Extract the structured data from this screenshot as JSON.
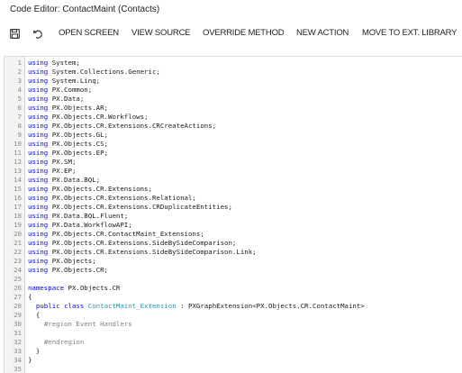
{
  "window": {
    "title": "Code Editor: ContactMaint (Contacts)"
  },
  "toolbar": {
    "save_icon": "save-icon",
    "undo_icon": "undo-icon",
    "buttons": [
      "OPEN SCREEN",
      "VIEW SOURCE",
      "OVERRIDE METHOD",
      "NEW ACTION",
      "MOVE TO EXT. LIBRARY"
    ]
  },
  "editor": {
    "lines": [
      {
        "n": "1",
        "segs": [
          {
            "t": "using",
            "c": "kw"
          },
          {
            "t": " System;",
            "c": ""
          }
        ]
      },
      {
        "n": "2",
        "segs": [
          {
            "t": "using",
            "c": "kw"
          },
          {
            "t": " System.Collections.Generic;",
            "c": ""
          }
        ]
      },
      {
        "n": "3",
        "segs": [
          {
            "t": "using",
            "c": "kw"
          },
          {
            "t": " System.Linq;",
            "c": ""
          }
        ]
      },
      {
        "n": "4",
        "segs": [
          {
            "t": "using",
            "c": "kw"
          },
          {
            "t": " PX.Common;",
            "c": ""
          }
        ]
      },
      {
        "n": "5",
        "segs": [
          {
            "t": "using",
            "c": "kw"
          },
          {
            "t": " PX.Data;",
            "c": ""
          }
        ]
      },
      {
        "n": "6",
        "segs": [
          {
            "t": "using",
            "c": "kw"
          },
          {
            "t": " PX.Objects.AR;",
            "c": ""
          }
        ]
      },
      {
        "n": "7",
        "segs": [
          {
            "t": "using",
            "c": "kw"
          },
          {
            "t": " PX.Objects.CR.Workflows;",
            "c": ""
          }
        ]
      },
      {
        "n": "8",
        "segs": [
          {
            "t": "using",
            "c": "kw"
          },
          {
            "t": " PX.Objects.CR.Extensions.CRCreateActions;",
            "c": ""
          }
        ]
      },
      {
        "n": "9",
        "segs": [
          {
            "t": "using",
            "c": "kw"
          },
          {
            "t": " PX.Objects.GL;",
            "c": ""
          }
        ]
      },
      {
        "n": "10",
        "segs": [
          {
            "t": "using",
            "c": "kw"
          },
          {
            "t": " PX.Objects.CS;",
            "c": ""
          }
        ]
      },
      {
        "n": "11",
        "segs": [
          {
            "t": "using",
            "c": "kw"
          },
          {
            "t": " PX.Objects.EP;",
            "c": ""
          }
        ]
      },
      {
        "n": "12",
        "segs": [
          {
            "t": "using",
            "c": "kw"
          },
          {
            "t": " PX.SM;",
            "c": ""
          }
        ]
      },
      {
        "n": "13",
        "segs": [
          {
            "t": "using",
            "c": "kw"
          },
          {
            "t": " PX.EP;",
            "c": ""
          }
        ]
      },
      {
        "n": "14",
        "segs": [
          {
            "t": "using",
            "c": "kw"
          },
          {
            "t": " PX.Data.BQL;",
            "c": ""
          }
        ]
      },
      {
        "n": "15",
        "segs": [
          {
            "t": "using",
            "c": "kw"
          },
          {
            "t": " PX.Objects.CR.Extensions;",
            "c": ""
          }
        ]
      },
      {
        "n": "16",
        "segs": [
          {
            "t": "using",
            "c": "kw"
          },
          {
            "t": " PX.Objects.CR.Extensions.Relational;",
            "c": ""
          }
        ]
      },
      {
        "n": "17",
        "segs": [
          {
            "t": "using",
            "c": "kw"
          },
          {
            "t": " PX.Objects.CR.Extensions.CRDuplicateEntities;",
            "c": ""
          }
        ]
      },
      {
        "n": "18",
        "segs": [
          {
            "t": "using",
            "c": "kw"
          },
          {
            "t": " PX.Data.BQL.Fluent;",
            "c": ""
          }
        ]
      },
      {
        "n": "19",
        "segs": [
          {
            "t": "using",
            "c": "kw"
          },
          {
            "t": " PX.Data.WorkflowAPI;",
            "c": ""
          }
        ]
      },
      {
        "n": "20",
        "segs": [
          {
            "t": "using",
            "c": "kw"
          },
          {
            "t": " PX.Objects.CR.ContactMaint_Extensions;",
            "c": ""
          }
        ]
      },
      {
        "n": "21",
        "segs": [
          {
            "t": "using",
            "c": "kw"
          },
          {
            "t": " PX.Objects.CR.Extensions.SideBySideComparison;",
            "c": ""
          }
        ]
      },
      {
        "n": "22",
        "segs": [
          {
            "t": "using",
            "c": "kw"
          },
          {
            "t": " PX.Objects.CR.Extensions.SideBySideComparison.Link;",
            "c": ""
          }
        ]
      },
      {
        "n": "23",
        "segs": [
          {
            "t": "using",
            "c": "kw"
          },
          {
            "t": " PX.Objects;",
            "c": ""
          }
        ]
      },
      {
        "n": "24",
        "segs": [
          {
            "t": "using",
            "c": "kw"
          },
          {
            "t": " PX.Objects.CR;",
            "c": ""
          }
        ]
      },
      {
        "n": "25",
        "segs": []
      },
      {
        "n": "26",
        "segs": [
          {
            "t": "namespace",
            "c": "kw"
          },
          {
            "t": " PX.Objects.CR",
            "c": ""
          }
        ]
      },
      {
        "n": "27",
        "segs": [
          {
            "t": "{",
            "c": ""
          }
        ]
      },
      {
        "n": "28",
        "segs": [
          {
            "t": "  ",
            "c": ""
          },
          {
            "t": "public",
            "c": "kw"
          },
          {
            "t": " ",
            "c": ""
          },
          {
            "t": "class",
            "c": "kw"
          },
          {
            "t": " ",
            "c": ""
          },
          {
            "t": "ContactMaint_Extension",
            "c": "ty"
          },
          {
            "t": " : PXGraphExtension<PX.Objects.CR.ContactMaint>",
            "c": ""
          }
        ]
      },
      {
        "n": "29",
        "segs": [
          {
            "t": "  {",
            "c": ""
          }
        ]
      },
      {
        "n": "30",
        "segs": [
          {
            "t": "    ",
            "c": ""
          },
          {
            "t": "#region Event Handlers",
            "c": "pp"
          }
        ]
      },
      {
        "n": "31",
        "segs": []
      },
      {
        "n": "32",
        "segs": [
          {
            "t": "    ",
            "c": ""
          },
          {
            "t": "#endregion",
            "c": "pp"
          }
        ]
      },
      {
        "n": "33",
        "segs": [
          {
            "t": "  }",
            "c": ""
          }
        ]
      },
      {
        "n": "34",
        "segs": [
          {
            "t": "}",
            "c": ""
          }
        ]
      },
      {
        "n": "35",
        "segs": []
      }
    ]
  },
  "colors": {
    "keyword": "#0000ff",
    "type": "#2b91af",
    "preprocessor": "#808080",
    "line_number": "#8a8a8a",
    "gutter": "#f3f3f3"
  }
}
